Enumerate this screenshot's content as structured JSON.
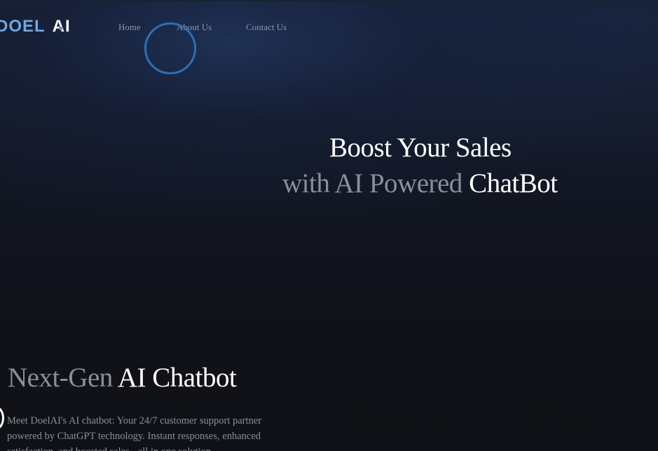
{
  "brand": {
    "logo_part1": "DOEL",
    "logo_part2": "AI"
  },
  "nav": {
    "items": [
      {
        "label": "Home"
      },
      {
        "label": "About Us"
      },
      {
        "label": "Contact Us"
      }
    ]
  },
  "hero": {
    "line1": "Boost Your Sales",
    "line2_muted": "with AI Powered",
    "line2_bright": "ChatBot"
  },
  "section": {
    "title_muted": "Next-Gen",
    "title_bright": "AI Chatbot",
    "description": "Meet DoelAI's AI chatbot: Your 24/7 customer support partner powered by ChatGPT technology. Instant responses, enhanced satisfaction, and boosted sales - all in one solution."
  },
  "colors": {
    "background": "#101218",
    "accent": "#6fa7e2",
    "cursor_ring": "#2f6fb3",
    "muted_text": "#8a8f99"
  }
}
